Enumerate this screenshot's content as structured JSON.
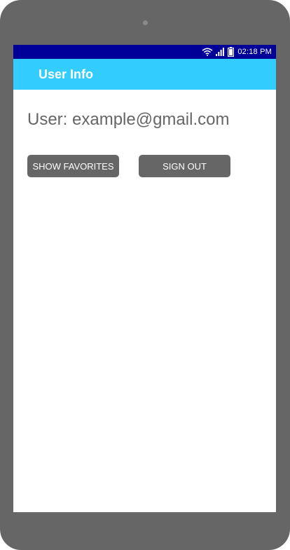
{
  "status_bar": {
    "time": "02:18 PM",
    "icons": [
      "wifi-icon",
      "signal-icon",
      "battery-icon"
    ],
    "background_color": "#000099"
  },
  "app_bar": {
    "title": "User Info",
    "background_color": "#33ccff"
  },
  "main": {
    "user_text": "User: example@gmail.com",
    "buttons": {
      "show_favorites": "SHOW FAVORITES",
      "sign_out": "SIGN OUT"
    }
  },
  "colors": {
    "device_frame": "#666666",
    "button_background": "#666666",
    "text_muted": "#666666"
  }
}
